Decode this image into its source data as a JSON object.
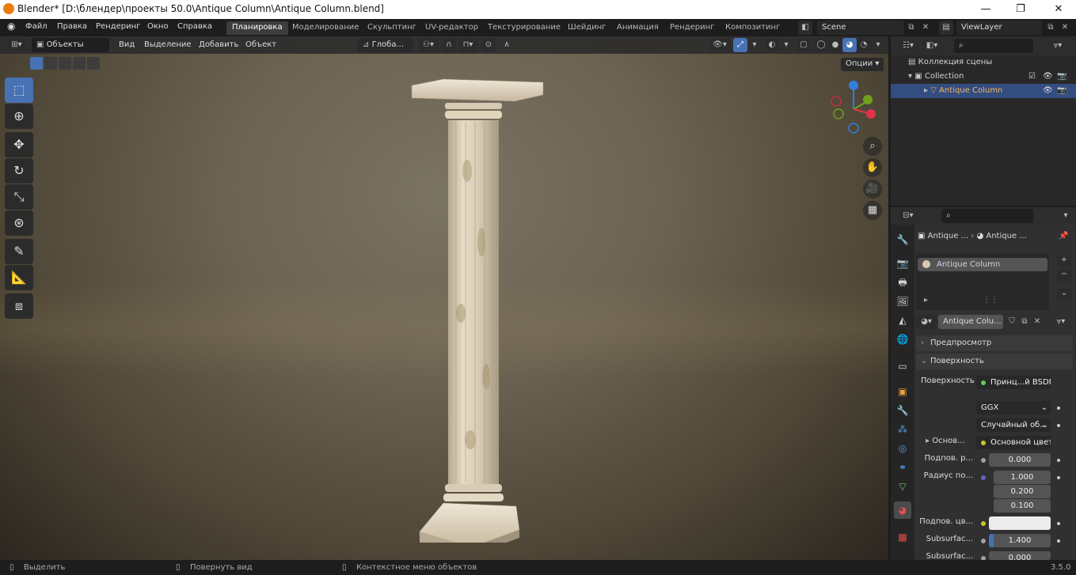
{
  "window": {
    "title": "Blender* [D:\\блендер\\проекты 50.0\\Antique Column\\Antique Column.blend]",
    "minimize": "—",
    "maximize": "❐",
    "close": "✕"
  },
  "menu": [
    "Файл",
    "Правка",
    "Рендеринг",
    "Окно",
    "Справка"
  ],
  "workspaces": [
    "Планировка",
    "Моделирование",
    "Скульптинг",
    "UV-редактор",
    "Текстурирование",
    "Шейдинг",
    "Анимация",
    "Рендеринг",
    "Композитинг"
  ],
  "active_workspace": "Планировка",
  "scene": {
    "name": "Scene",
    "view_layer": "ViewLayer"
  },
  "viewport": {
    "mode": "Объекты",
    "menu": [
      "Вид",
      "Выделение",
      "Добавить",
      "Объект"
    ],
    "orientation": "Глоба...",
    "options_label": "Опции"
  },
  "outliner": {
    "root": "Коллекция сцены",
    "collection": "Collection",
    "object": "Antique Column"
  },
  "properties": {
    "breadcrumb": [
      "Antique ...",
      "Antique ..."
    ],
    "slot": "Antique Column",
    "material_name": "Antique Colu...",
    "sections": {
      "preview": "Предпросмотр",
      "surface": "Поверхность"
    },
    "rows": {
      "surface_label": "Поверхность",
      "surface_value": "Принц...й BSDF",
      "distribution": "GGX",
      "subsurface_method": "Случайный об...",
      "base_label": "Основ...",
      "base_value": "Основной цвет",
      "subsurface_label": "Подпов. р...",
      "subsurface_value": "0.000",
      "radius_label": "Радиус по...",
      "radius_values": [
        "1.000",
        "0.200",
        "0.100"
      ],
      "subsurface_color_label": "Подпов. цв...",
      "subsurface_ior_label": "Subsurfac...",
      "subsurface_ior_value": "1.400",
      "subsurface_aniso_label": "Subsurfac...",
      "subsurface_aniso_value": "0.000"
    }
  },
  "status": {
    "select": "Выделить",
    "rotate": "Повернуть вид",
    "context": "Контекстное меню объектов",
    "version": "3.5.0"
  },
  "colors": {
    "accent": "#4772b3",
    "socket_yellow": "#c7c729",
    "socket_blue": "#6363c7",
    "socket_green": "#63c763",
    "logo": "#e87d0d"
  }
}
